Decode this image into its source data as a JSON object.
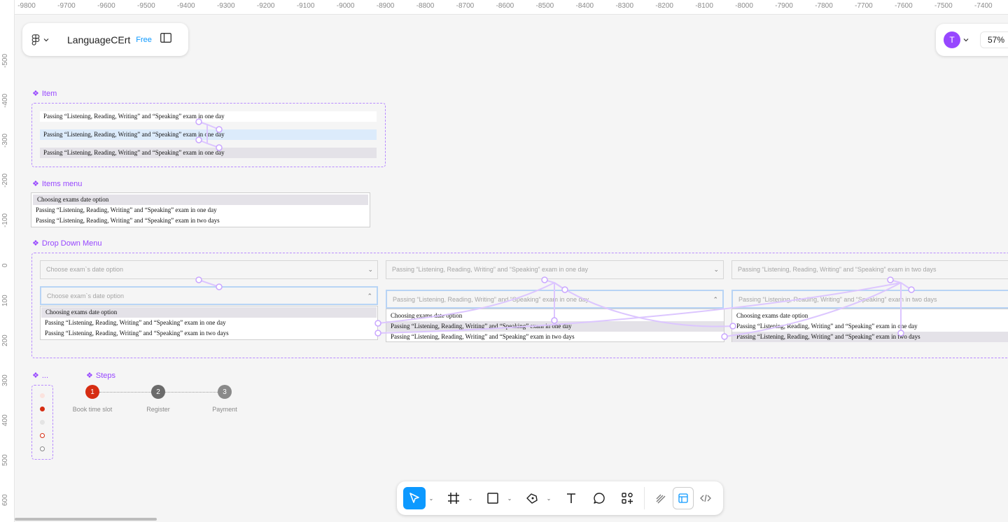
{
  "ruler": {
    "top_ticks": [
      "-9800",
      "-9700",
      "-9600",
      "-9500",
      "-9400",
      "-9300",
      "-9200",
      "-9100",
      "-9000",
      "-8900",
      "-8800",
      "-8700",
      "-8600",
      "-8500",
      "-8400",
      "-8300",
      "-8200",
      "-8100",
      "-8000",
      "-7900",
      "-7800",
      "-7700",
      "-7600",
      "-7500",
      "-7400"
    ],
    "left_ticks": [
      "-500",
      "-400",
      "-300",
      "-200",
      "-100",
      "0",
      "100",
      "200",
      "300",
      "400",
      "500",
      "600"
    ]
  },
  "project": {
    "name": "LanguageCErt",
    "plan_badge": "Free",
    "menu_icon": "figma-logo-icon",
    "sidebar_icon": "sidebar-toggle-icon"
  },
  "collab": {
    "avatar_initial": "T",
    "avatar_color": "#9747ff",
    "zoom": "57%"
  },
  "components": {
    "item": {
      "title": "Item",
      "rows": [
        "Passing “Listening, Reading, Writing” and “Speaking” exam in one day",
        "Passing “Listening, Reading, Writing” and “Speaking” exam in one day",
        "Passing “Listening, Reading, Writing” and “Speaking” exam in one day"
      ]
    },
    "items_menu": {
      "title": "Items menu",
      "rows": [
        "Choosing exams date option",
        "Passing “Listening, Reading, Writing” and “Speaking” exam in one day",
        "Passing “Listening, Reading, Writing” and “Speaking” exam in two days"
      ]
    },
    "dropdown": {
      "title": "Drop Down Menu",
      "placeholder": "Choose exam`s date option",
      "selected_one_day": "Passing “Listening, Reading, Writing” and “Speaking” exam in one day",
      "selected_two_days": "Passing “Listening, Reading, Writing” and “Speaking” exam in two days",
      "options": [
        "Choosing exams date option",
        "Passing “Listening, Reading, Writing” and “Speaking” exam in one day",
        "Passing “Listening, Reading, Writing” and “Speaking” exam in two days"
      ]
    },
    "dots": {
      "title": "..."
    },
    "steps": {
      "title": "Steps",
      "items": [
        {
          "number": "1",
          "label": "Book time slot",
          "color": "#d62d12"
        },
        {
          "number": "2",
          "label": "Register",
          "color": "#6b6b6b"
        },
        {
          "number": "3",
          "label": "Payment",
          "color": "#8a8a8a"
        }
      ]
    }
  },
  "toolbar": {
    "tools": [
      "move-tool-icon",
      "frame-tool-icon",
      "shape-tool-icon",
      "pen-tool-icon",
      "text-tool-icon",
      "comment-tool-icon",
      "actions-icon"
    ],
    "modes": [
      "draw-mode-icon",
      "design-mode-icon",
      "dev-mode-icon"
    ]
  },
  "colors": {
    "accent": "#0d99ff",
    "component": "#9747ff",
    "selection": "#e4e2e8",
    "hover": "#dcebfb"
  }
}
